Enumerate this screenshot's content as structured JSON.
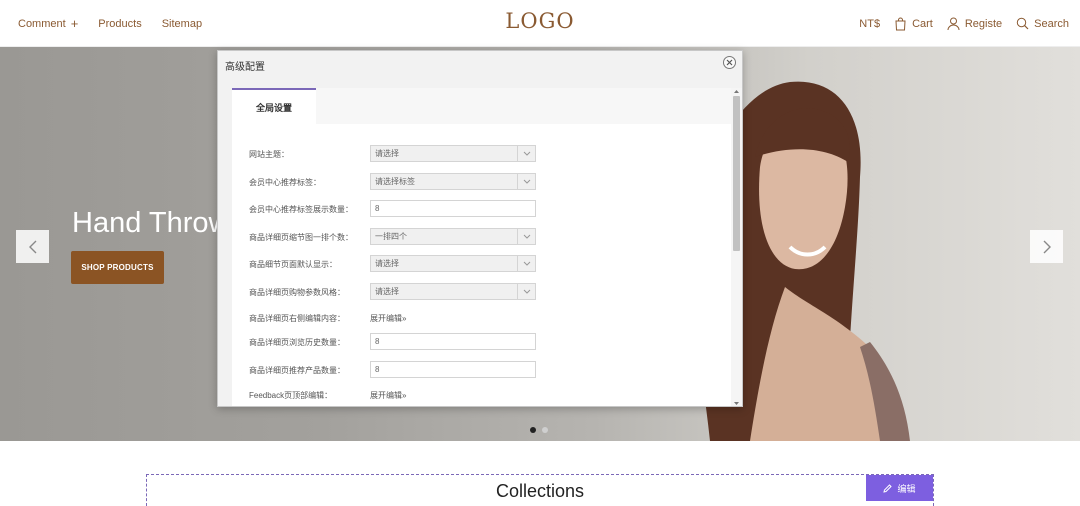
{
  "header": {
    "nav_left": [
      {
        "label": "Comment",
        "icon": "plus-icon"
      },
      {
        "label": "Products"
      },
      {
        "label": "Sitemap"
      }
    ],
    "logo": "LOGO",
    "currency": "NT$",
    "cart_label": "Cart",
    "register_label": "Registe",
    "search_label": "Search"
  },
  "hero": {
    "headline": "Hand Throw",
    "cta_label": "SHOP PRODUCTS",
    "slide_count": 2,
    "active_slide": 1
  },
  "modal": {
    "title": "高级配置",
    "tab_label": "全局设置",
    "rows": [
      {
        "label": "网站主题：",
        "type": "select",
        "value": "请选择"
      },
      {
        "label": "会员中心推荐标签：",
        "type": "select",
        "value": "请选择标签"
      },
      {
        "label": "会员中心推荐标签展示数量：",
        "type": "input",
        "value": "8"
      },
      {
        "label": "商品详细页缩节图一排个数：",
        "type": "select",
        "value": "一排四个"
      },
      {
        "label": "商品细节页面默认显示：",
        "type": "select",
        "value": "请选择"
      },
      {
        "label": "商品详细页购物参数风格：",
        "type": "select",
        "value": "请选择"
      },
      {
        "label": "商品详细页右侧编辑内容：",
        "type": "link",
        "value": "展开编辑»"
      },
      {
        "label": "商品详细页浏览历史数量：",
        "type": "input",
        "value": "8"
      },
      {
        "label": "商品详细页推荐产品数量：",
        "type": "input",
        "value": "8"
      },
      {
        "label": "Feedback页顶部编辑：",
        "type": "link",
        "value": "展开编辑»"
      }
    ]
  },
  "collections": {
    "title": "Collections",
    "edit_label": "编辑"
  },
  "colors": {
    "brand": "#8a5a32",
    "cta": "#8b5424",
    "accent": "#7d5fe0",
    "tab_accent": "#7b68b8"
  }
}
